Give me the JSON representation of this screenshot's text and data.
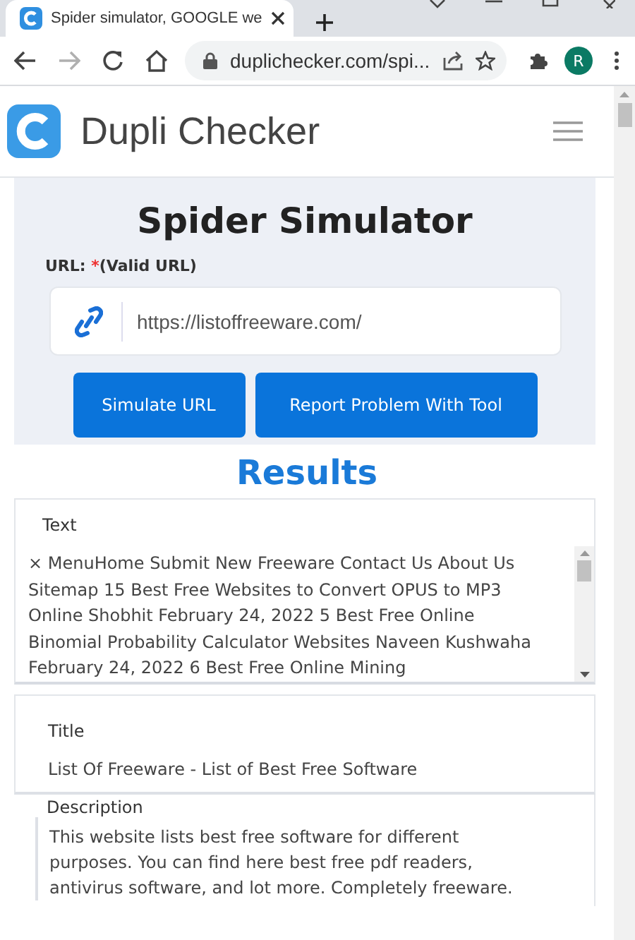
{
  "browser": {
    "tabs": [
      {
        "title": "Spider simulator, GOOGLE we",
        "selected": true
      }
    ],
    "back_disabled": false,
    "forward_disabled": true,
    "address": "duplichecker.com/spi...",
    "profile_initial": "R"
  },
  "site": {
    "logo_text": "Dupli Checker"
  },
  "tool": {
    "title": "Spider Simulator",
    "url_label": "URL: ",
    "required_mark": "*",
    "url_hint": "(Valid URL)",
    "url_value": "https://listoffreeware.com/",
    "buttons": [
      "Simulate URL",
      "Report Problem With Tool"
    ]
  },
  "results": {
    "heading": "Results",
    "text_label": "Text",
    "text_value": "× MenuHome Submit New Freeware Contact Us About Us Sitemap 15 Best Free Websites to Convert OPUS to MP3 Online Shobhit February 24, 2022 5 Best Free Online Binomial Probability Calculator Websites Naveen Kushwaha February 24, 2022 6 Best Free Online Mining",
    "title_label": "Title",
    "title_value": "List Of Freeware - List of Best Free Software",
    "description_label": "Description",
    "description_value": "This website lists best free software for different purposes. You can find here best free pdf readers, antivirus software, and lot more. Completely freeware."
  }
}
